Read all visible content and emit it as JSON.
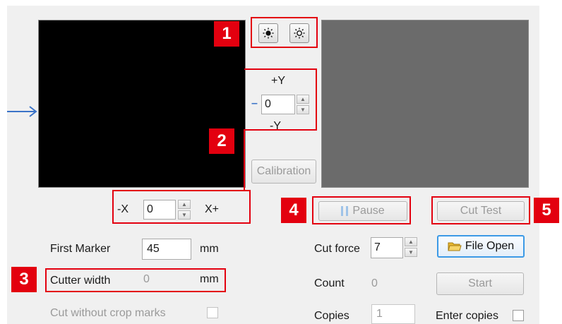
{
  "brightness": {
    "badge": "1",
    "decrease_icon": "brightness-down-icon",
    "increase_icon": "brightness-up-icon"
  },
  "y_adjust": {
    "plus_label": "+Y",
    "minus_label": "-Y",
    "minus_marker": "–",
    "value": "0"
  },
  "x_adjust": {
    "minus_label": "-X",
    "plus_label": "X+",
    "value": "0"
  },
  "calibration_label": "Calibration",
  "badges": {
    "b1": "1",
    "b2": "2",
    "b3": "3",
    "b4": "4",
    "b5": "5"
  },
  "pause_label": "Pause",
  "cut_test_label": "Cut Test",
  "first_marker": {
    "label": "First Marker",
    "value": "45",
    "unit": "mm"
  },
  "cutter_width": {
    "label": "Cutter width",
    "value": "0",
    "unit": "mm"
  },
  "cut_without_crop_marks": {
    "label": "Cut without crop marks",
    "checked": false
  },
  "cut_force": {
    "label": "Cut force",
    "value": "7"
  },
  "file_open_label": "File Open",
  "count": {
    "label": "Count",
    "value": "0"
  },
  "start_label": "Start",
  "copies": {
    "label": "Copies",
    "value": "1"
  },
  "enter_copies": {
    "label": "Enter copies",
    "checked": false
  },
  "colors": {
    "accent_red": "#e3000f",
    "arrow_blue": "#3b73c8",
    "file_open_border": "#3c9ae6"
  }
}
